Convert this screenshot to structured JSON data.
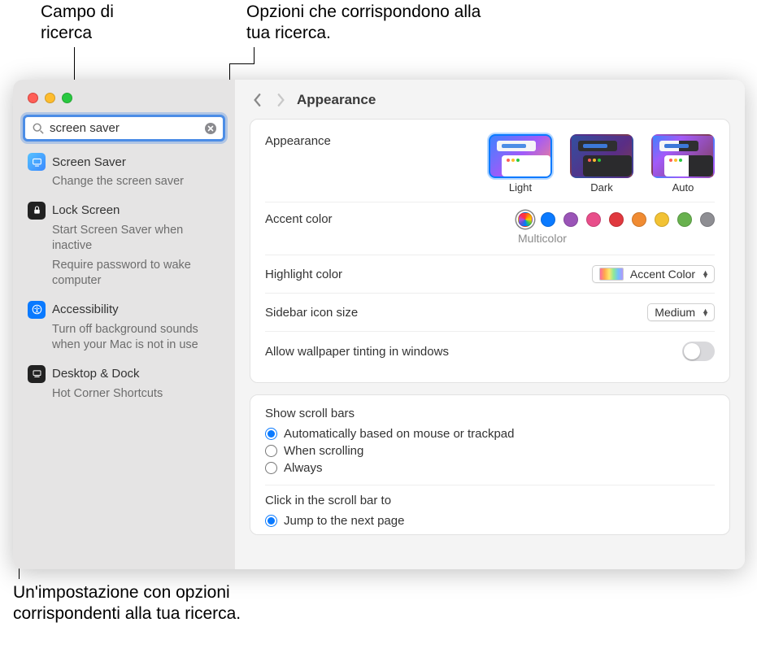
{
  "callouts": {
    "search_field": "Campo di ricerca",
    "matching_options": "Opzioni che corrispondono alla tua ricerca.",
    "matching_setting": "Un'impostazione con opzioni corrispondenti alla tua ricerca."
  },
  "sidebar": {
    "search_value": "screen saver",
    "groups": [
      {
        "icon": "screensaver",
        "title": "Screen Saver",
        "items": [
          "Change the screen saver"
        ]
      },
      {
        "icon": "lock",
        "title": "Lock Screen",
        "items": [
          "Start Screen Saver when inactive",
          "Require password to wake computer"
        ]
      },
      {
        "icon": "accessibility",
        "title": "Accessibility",
        "items": [
          "Turn off background sounds when your Mac is not in use"
        ]
      },
      {
        "icon": "dock",
        "title": "Desktop & Dock",
        "items": [
          "Hot Corner Shortcuts"
        ]
      }
    ]
  },
  "header": {
    "page_title": "Appearance"
  },
  "panel1": {
    "appearance_label": "Appearance",
    "modes": [
      {
        "key": "light",
        "label": "Light",
        "selected": true
      },
      {
        "key": "dark",
        "label": "Dark",
        "selected": false
      },
      {
        "key": "auto",
        "label": "Auto",
        "selected": false
      }
    ],
    "accent_label": "Accent color",
    "accent_selected_name": "Multicolor",
    "accents": [
      {
        "name": "multicolor",
        "color": "multi",
        "selected": true
      },
      {
        "name": "blue",
        "color": "#0a7aff"
      },
      {
        "name": "purple",
        "color": "#9a54b7"
      },
      {
        "name": "pink",
        "color": "#e84e8a"
      },
      {
        "name": "red",
        "color": "#e0383e"
      },
      {
        "name": "orange",
        "color": "#f08b32"
      },
      {
        "name": "yellow",
        "color": "#f2c234"
      },
      {
        "name": "green",
        "color": "#68b14e"
      },
      {
        "name": "graphite",
        "color": "#8e8e93"
      }
    ],
    "highlight_label": "Highlight color",
    "highlight_value": "Accent Color",
    "sidebar_size_label": "Sidebar icon size",
    "sidebar_size_value": "Medium",
    "wallpaper_tint_label": "Allow wallpaper tinting in windows"
  },
  "panel2": {
    "scrollbars_title": "Show scroll bars",
    "scrollbars_options": [
      "Automatically based on mouse or trackpad",
      "When scrolling",
      "Always"
    ],
    "scrollbars_selected": 0,
    "click_title": "Click in the scroll bar to",
    "click_options": [
      "Jump to the next page"
    ],
    "click_selected": 0
  }
}
